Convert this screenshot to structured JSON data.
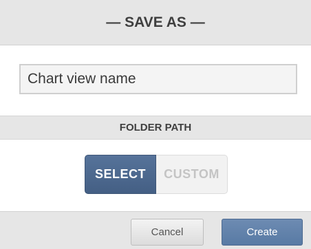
{
  "dialog": {
    "title": "— SAVE AS —"
  },
  "name_field": {
    "value": "Chart view name"
  },
  "folder_path": {
    "header": "FOLDER PATH",
    "options": [
      "SELECT",
      "CUSTOM"
    ],
    "selected": "SELECT"
  },
  "footer": {
    "cancel_label": "Cancel",
    "create_label": "Create"
  },
  "colors": {
    "accent": "#4b6890",
    "header_bg": "#e6e6e6",
    "inactive_text": "#c4c4c4"
  }
}
